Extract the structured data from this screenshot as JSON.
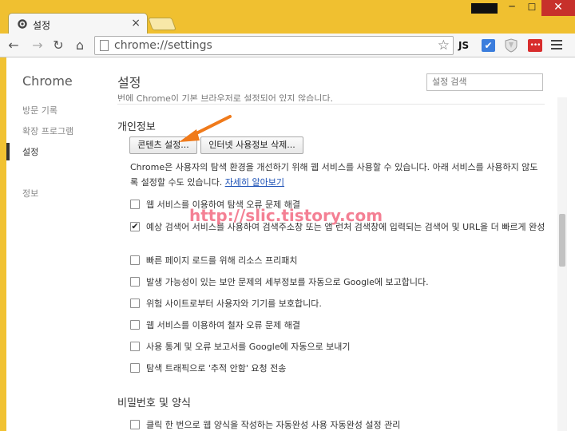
{
  "window": {
    "tab_title": "설정",
    "tab_close": "×",
    "min": "─",
    "max": "☐",
    "close": "✕"
  },
  "toolbar": {
    "back": "←",
    "forward": "→",
    "reload": "↻",
    "home": "⌂",
    "url": "chrome://settings",
    "star": "☆",
    "ext_js": "JS",
    "ext_check": "✔",
    "ext_red": "•••"
  },
  "sidebar": {
    "title": "Chrome",
    "items": [
      {
        "label": "방문 기록"
      },
      {
        "label": "확장 프로그램"
      },
      {
        "label": "설정"
      },
      {
        "label": "정보"
      }
    ]
  },
  "main": {
    "title": "설정",
    "search_placeholder": "설정 검색",
    "cut_text": "번에 Chrome이 기본 브라우저로 설정되어 있지 않습니다.",
    "privacy": {
      "heading": "개인정보",
      "content_settings_button": "콘텐츠 설정...",
      "clear_data_button": "인터넷 사용정보 삭제...",
      "description": "Chrome은 사용자의 탐색 환경을 개선하기 위해 웹 서비스를 사용할 수 있습니다. 아래 서비스를 사용하지 않도록 설정할 수도 있습니다.",
      "learn_more": "자세히 알아보기",
      "options": [
        {
          "label": "웹 서비스를 이용하여 탐색 오류 문제 해결",
          "checked": false
        },
        {
          "label": "예상 검색어 서비스를 사용하여 검색주소창 또는 앱 런처 검색창에 입력되는 검색어 및 URL을 더 빠르게 완성",
          "checked": true
        },
        {
          "label": "빠른 페이지 로드를 위해 리소스 프리패치",
          "checked": false
        },
        {
          "label": "발생 가능성이 있는 보안 문제의 세부정보를 자동으로 Google에 보고합니다.",
          "checked": false
        },
        {
          "label": "위험 사이트로부터 사용자와 기기를 보호합니다.",
          "checked": false
        },
        {
          "label": "웹 서비스를 이용하여 철자 오류 문제 해결",
          "checked": false
        },
        {
          "label": "사용 통계 및 오류 보고서를 Google에 자동으로 보내기",
          "checked": false
        },
        {
          "label": "탐색 트래픽으로 '추적 안함' 요청 전송",
          "checked": false
        }
      ]
    },
    "passwords": {
      "heading": "비밀번호 및 양식",
      "cut_option": "클릭 한 번으로 웹 양식을 작성하는 자동완성 사용 자동완성 설정 관리"
    }
  },
  "watermark": "http://slic.tistory.com",
  "colors": {
    "frame": "#f0c030",
    "close": "#c7302b",
    "link": "#1a4fb5",
    "arrow": "#f07a1a",
    "watermark": "#f36a82"
  }
}
